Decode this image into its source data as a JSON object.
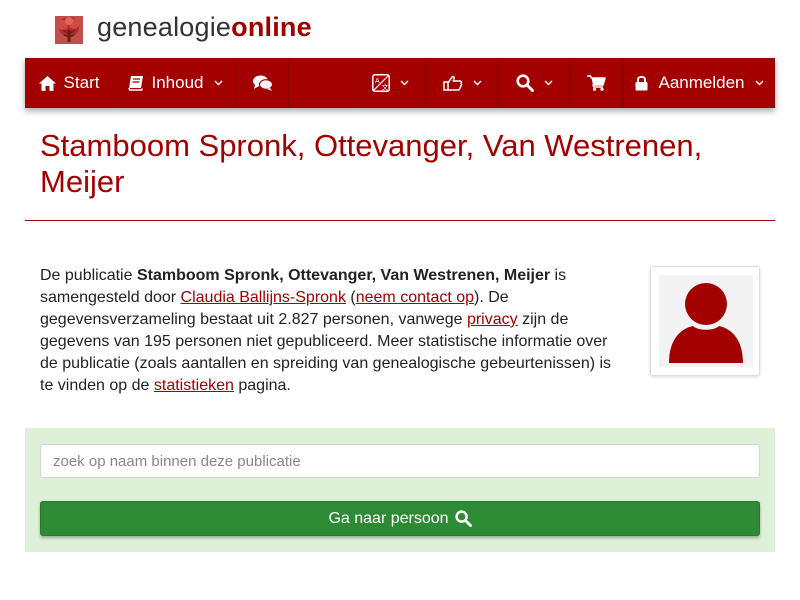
{
  "brand": {
    "part1": "genealogie",
    "part2": "online"
  },
  "nav": {
    "start_label": "Start",
    "inhoud_label": "Inhoud",
    "aanmelden_label": "Aanmelden",
    "icons": [
      "home-icon",
      "book-icon",
      "comments-icon",
      "language-icon",
      "thumbs-up-icon",
      "search-icon",
      "cart-icon",
      "lock-icon"
    ]
  },
  "page": {
    "title": "Stamboom Spronk, Ottevanger, Van Westrenen, Meijer"
  },
  "description": {
    "t1": "De publicatie ",
    "pub_name": "Stamboom Spronk, Ottevanger, Van Westrenen, Meijer",
    "t2": " is samengesteld door ",
    "author": "Claudia Ballijns-Spronk",
    "t3": " (",
    "contact_link": "neem contact op",
    "t4": "). De gegevensverzameling bestaat uit 2.827 personen, vanwege ",
    "privacy_link": "privacy",
    "t5": " zijn de gegevens van 195 personen niet gepubliceerd. Meer statistische informatie over de publicatie (zoals aantallen en spreiding van genealogische gebeurtenissen) is te vinden op de ",
    "stats_link": "statistieken",
    "t6": " pagina."
  },
  "search": {
    "placeholder": "zoek op naam binnen deze publicatie",
    "button_label": "Ga naar persoon"
  },
  "colors": {
    "brand": "#a30000",
    "success": "#2e8b35",
    "panel": "#dff0d8"
  }
}
